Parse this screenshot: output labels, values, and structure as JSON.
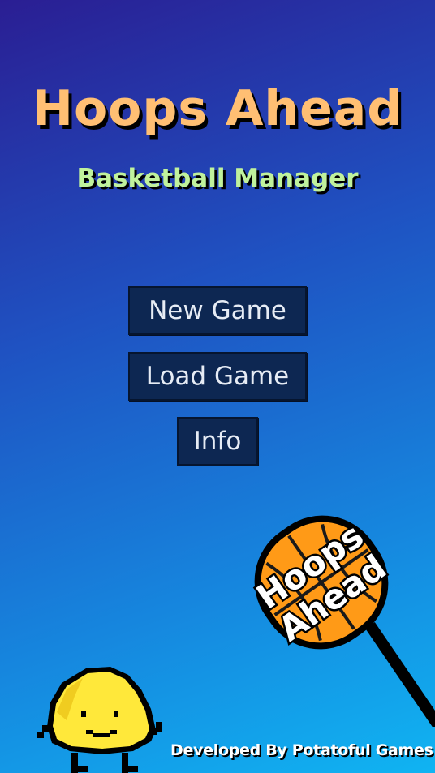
{
  "title": "Hoops Ahead",
  "subtitle": "Basketball Manager",
  "menu": {
    "new_game": "New Game",
    "load_game": "Load Game",
    "info": "Info"
  },
  "logo": {
    "line1": "Hoops",
    "line2": "Ahead"
  },
  "credit": "Developed By Potatoful Games",
  "colors": {
    "title": "#ffbf73",
    "subtitle": "#c0f29c",
    "button_bg": "#0d2752",
    "ball": "#ff9a17",
    "mascot": "#ffe83a"
  }
}
